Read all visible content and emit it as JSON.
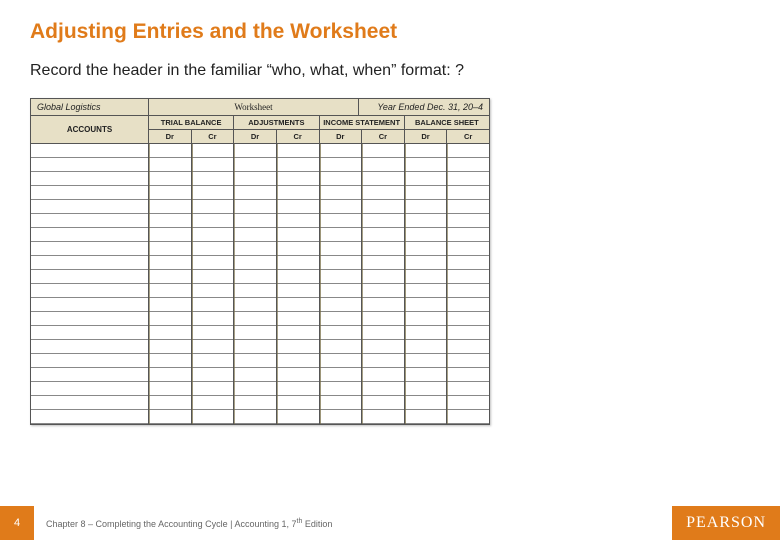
{
  "title": "Adjusting Entries and the Worksheet",
  "body": "Record the header in the familiar “who, what, when” format: ?",
  "worksheet": {
    "who": "Global Logistics",
    "what": "Worksheet",
    "when": "Year Ended Dec. 31, 20–4",
    "accounts_label": "ACCOUNTS",
    "sections": [
      "TRIAL BALANCE",
      "ADJUSTMENTS",
      "INCOME STATEMENT",
      "BALANCE SHEET"
    ],
    "dr": "Dr",
    "cr": "Cr"
  },
  "footer": {
    "page": "4",
    "crumb_prefix": "Chapter 8 – Completing the Accounting Cycle | Accounting 1, 7",
    "crumb_sup": "th",
    "crumb_suffix": " Edition",
    "brand": "PEARSON"
  }
}
